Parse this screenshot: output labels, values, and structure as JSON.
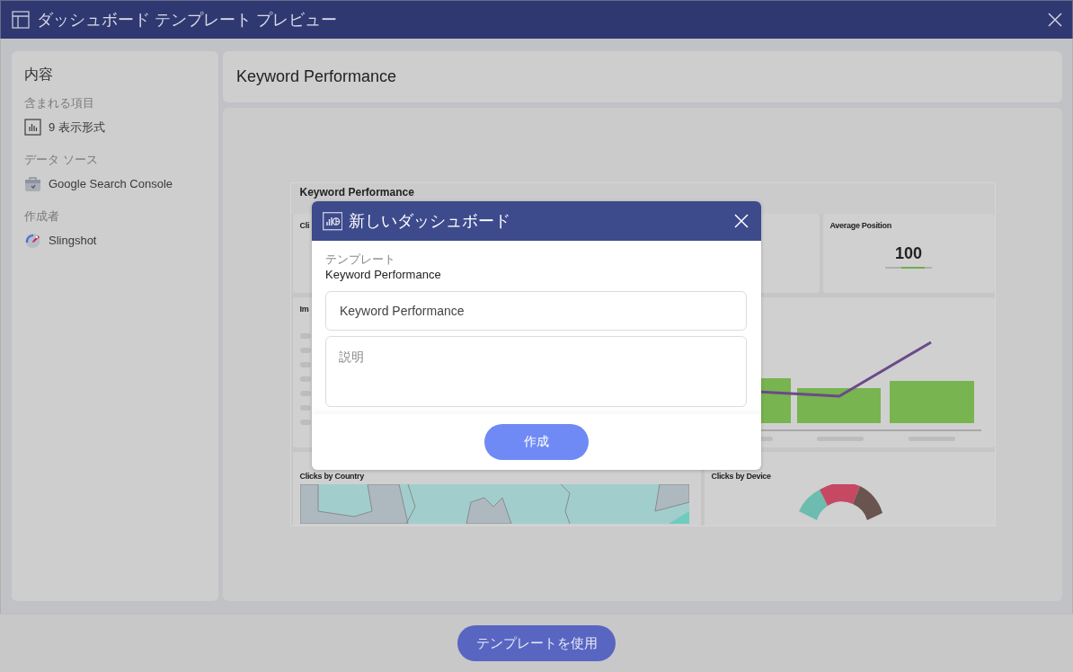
{
  "window": {
    "title": "ダッシュボード テンプレート プレビュー"
  },
  "sidebar": {
    "heading": "内容",
    "sections": [
      {
        "label": "含まれる項目",
        "value": "9 表示形式",
        "kind": "visualizations"
      },
      {
        "label": "データ ソース",
        "value": "Google Search Console",
        "kind": "datasource"
      },
      {
        "label": "作成者",
        "value": "Slingshot",
        "kind": "author"
      }
    ]
  },
  "main": {
    "title": "Keyword Performance"
  },
  "preview": {
    "title": "Keyword Performance",
    "cards": [
      {
        "kind": "kpi",
        "title": "Cli"
      },
      {
        "kind": "kpi"
      },
      {
        "kind": "kpi",
        "title": "Average Position",
        "value": "100"
      },
      {
        "kind": "list",
        "title": "Im"
      },
      {
        "kind": "bars"
      },
      {
        "kind": "map",
        "title": "Clicks by Country"
      },
      {
        "kind": "donut",
        "title": "Clicks by Device"
      }
    ]
  },
  "dialog": {
    "title": "新しいダッシュボード",
    "template_label": "テンプレート",
    "template_value": "Keyword Performance",
    "name_field": {
      "value": "Keyword Performance"
    },
    "description_field": {
      "placeholder": "説明"
    },
    "button": "作成"
  },
  "footer": {
    "button": "テンプレートを使用"
  }
}
